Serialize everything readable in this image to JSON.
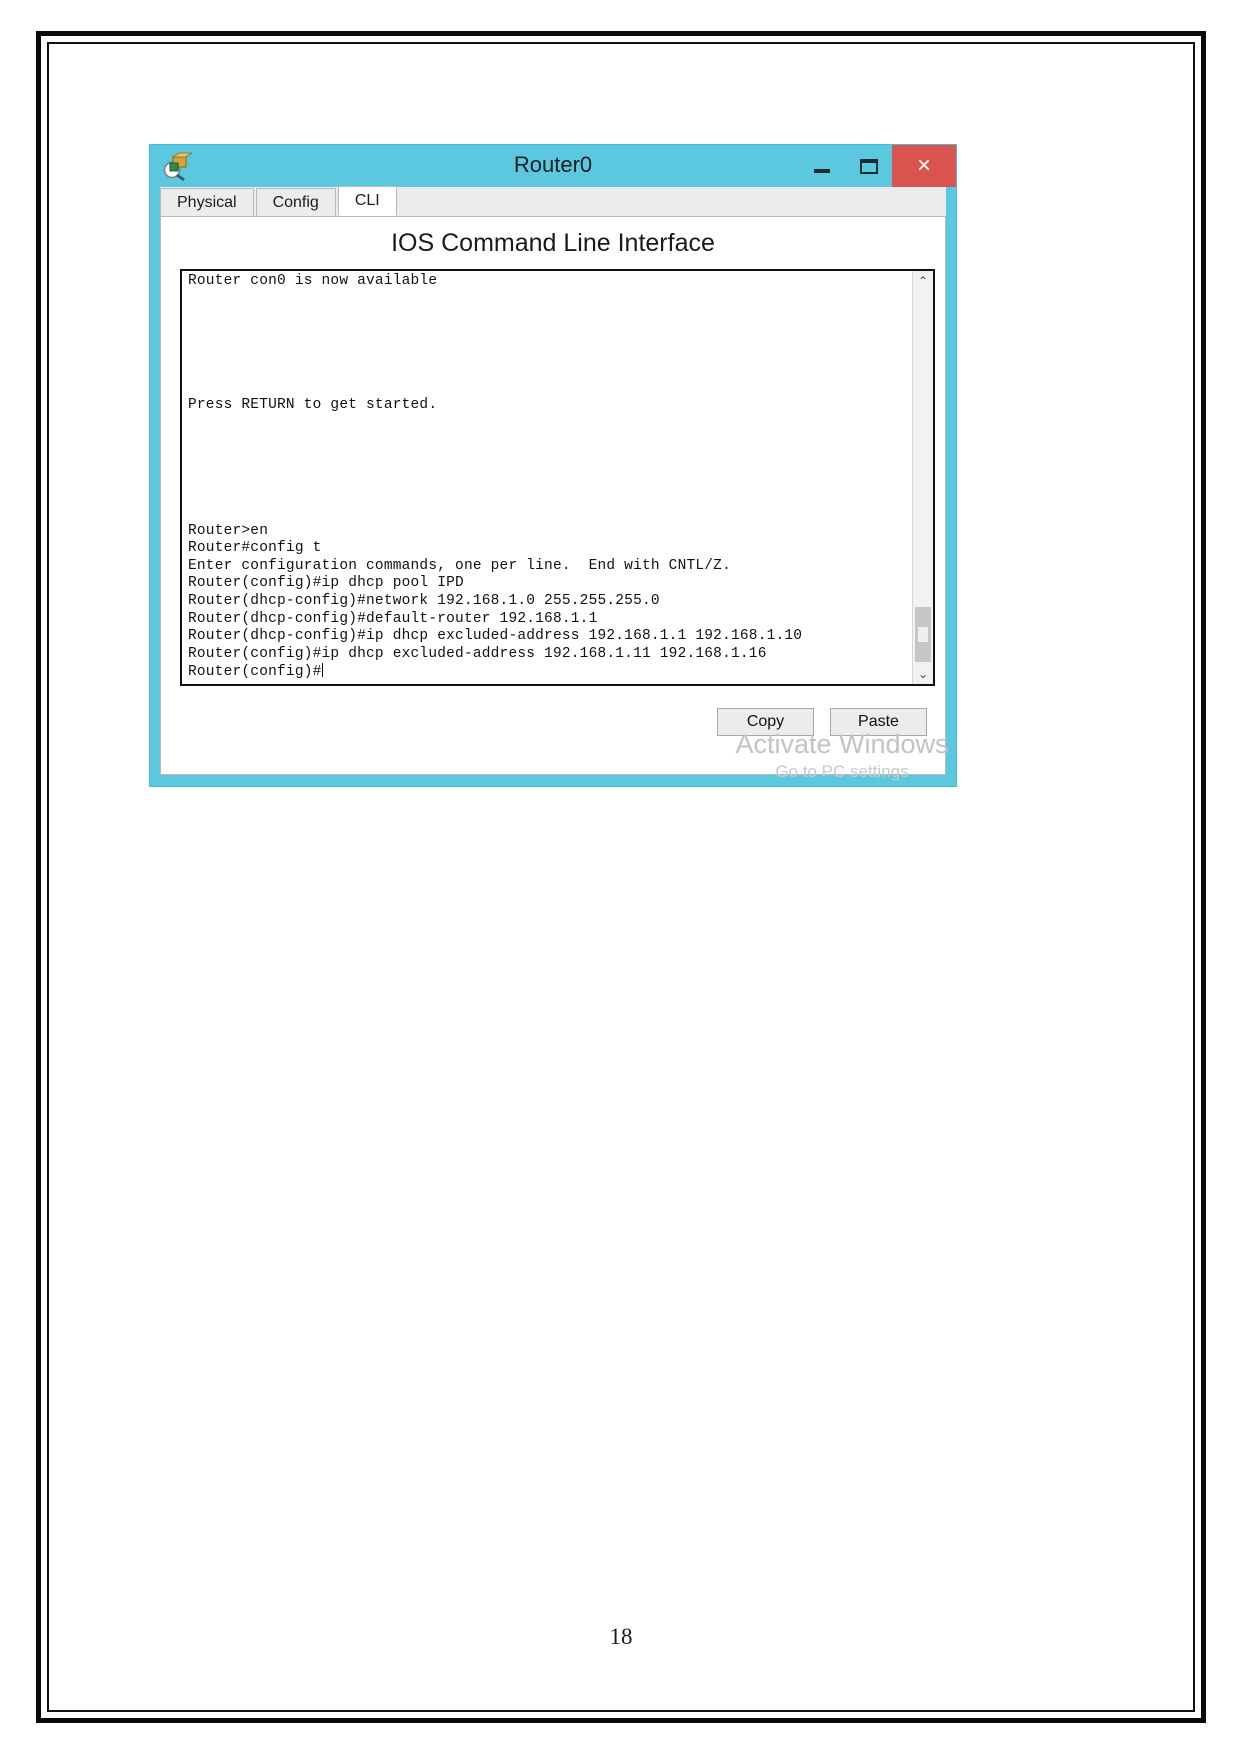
{
  "document": {
    "page_number": "18"
  },
  "window": {
    "title": "Router0",
    "icon": "packet-tracer-device-icon",
    "colors": {
      "titlebar": "#5bc8e0",
      "close_button": "#d9534f"
    },
    "controls": {
      "minimize": "–",
      "maximize": "□",
      "close": "×"
    }
  },
  "tabs": [
    {
      "label": "Physical",
      "active": false
    },
    {
      "label": "Config",
      "active": false
    },
    {
      "label": "CLI",
      "active": true
    }
  ],
  "panel": {
    "heading": "IOS Command Line Interface"
  },
  "terminal": {
    "top_lines": [
      "Router con0 is now available"
    ],
    "middle_lines": [
      "Press RETURN to get started."
    ],
    "bottom_lines": [
      "Router>en",
      "Router#config t",
      "Enter configuration commands, one per line.  End with CNTL/Z.",
      "Router(config)#ip dhcp pool IPD",
      "Router(dhcp-config)#network 192.168.1.0 255.255.255.0",
      "Router(dhcp-config)#default-router 192.168.1.1",
      "Router(dhcp-config)#ip dhcp excluded-address 192.168.1.1 192.168.1.10",
      "Router(config)#ip dhcp excluded-address 192.168.1.11 192.168.1.16"
    ],
    "prompt": "Router(config)#"
  },
  "scrollbar": {
    "up_arrow": "⌃",
    "down_arrow": "⌄"
  },
  "buttons": {
    "copy": "Copy",
    "paste": "Paste"
  },
  "watermark": {
    "line1": "Activate Windows",
    "line2": "Go to PC settings"
  }
}
